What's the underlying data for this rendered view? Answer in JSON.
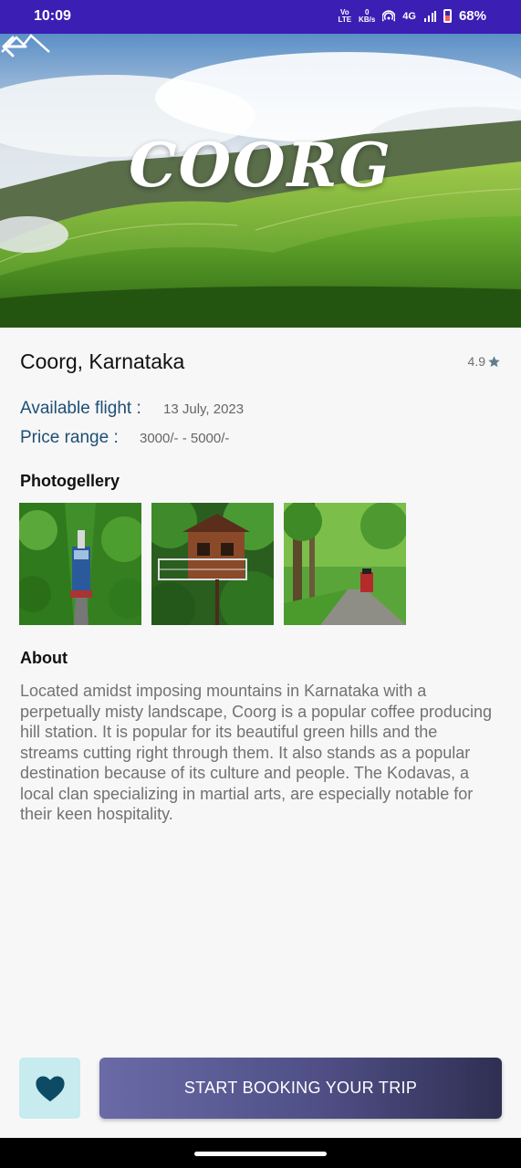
{
  "status_bar": {
    "time": "10:09",
    "volte_top": "Vo",
    "volte_bottom": "LTE",
    "speed_top": "0",
    "speed_bottom": "KB/s",
    "network": "4G",
    "battery": "68%"
  },
  "hero": {
    "title": "COORG",
    "back_icon": "arrow-back-icon"
  },
  "place": {
    "name": "Coorg, Karnataka",
    "rating": "4.9",
    "rating_icon": "star-icon"
  },
  "info": {
    "flight_label": "Available flight :",
    "flight_value": "13 July,  2023",
    "price_label": "Price range :",
    "price_value": "3000/- - 5000/-"
  },
  "gallery": {
    "title": "Photogellery"
  },
  "about": {
    "title": "About",
    "text": "Located amidst imposing mountains in Karnataka with a perpetually misty landscape, Coorg is a popular coffee producing hill station. It is popular for its beautiful green hills and the streams cutting right through them. It also stands as a popular destination because of its culture and people. The Kodavas, a local clan specializing in martial arts, are especially notable for their keen hospitality."
  },
  "actions": {
    "favorite_icon": "heart-icon",
    "book_label": "START BOOKING YOUR TRIP"
  },
  "colors": {
    "status_bar": "#3b1fb4",
    "label_blue": "#1d4f73",
    "fav_bg": "#c7ebee",
    "heart": "#0d4a64",
    "book_start": "#6a6aa7",
    "book_end": "#2f2f53"
  }
}
